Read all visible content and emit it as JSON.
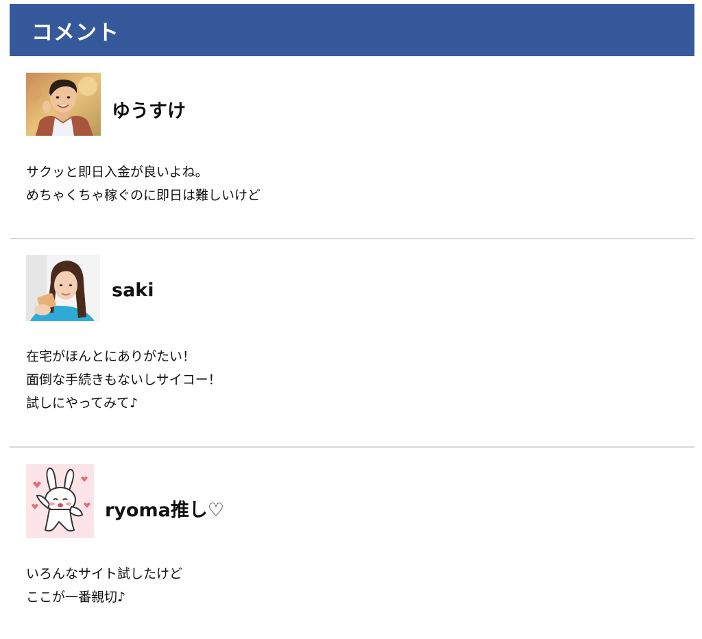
{
  "header": {
    "title": "コメント"
  },
  "comments": [
    {
      "name": "ゆうすけ",
      "avatar_icon": "man-photo-avatar",
      "lines": [
        "サクッと即日入金が良いよね。",
        "めちゃくちゃ稼ぐのに即日は難しいけど"
      ]
    },
    {
      "name": "saki",
      "avatar_icon": "woman-photo-avatar",
      "lines": [
        "在宅がほんとにありがたい！",
        "面倒な手続きもないしサイコー！",
        "試しにやってみて♪"
      ]
    },
    {
      "name": "ryoma推し♡",
      "avatar_icon": "rabbit-illustration-avatar",
      "lines": [
        "いろんなサイト試したけど",
        "ここが一番親切♪"
      ]
    }
  ],
  "colors": {
    "header_bg": "#36599c",
    "header_text": "#ffffff",
    "divider": "#d9d9d9"
  }
}
